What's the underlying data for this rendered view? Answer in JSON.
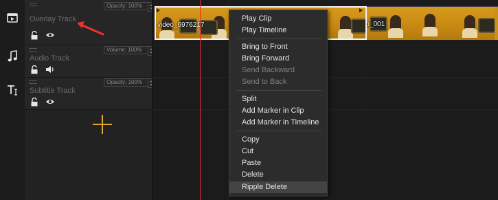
{
  "tracks": [
    {
      "name": "Overlay Track",
      "param": "Opacity: 100%",
      "icon": "play-box-icon",
      "controls": [
        "lock-icon",
        "eye-icon"
      ]
    },
    {
      "name": "Audio Track",
      "param": "Volume: 100%",
      "icon": "music-note-icon",
      "controls": [
        "lock-icon",
        "speaker-icon"
      ]
    },
    {
      "name": "Subtitle Track",
      "param": "Opacity: 100%",
      "icon": "text-icon",
      "controls": [
        "lock-icon",
        "eye-icon"
      ]
    }
  ],
  "clips": [
    {
      "label": "video_6976217",
      "selected": true
    },
    {
      "label": "video_001"
    }
  ],
  "context_menu": {
    "groups": [
      [
        {
          "label": "Play Clip",
          "enabled": true
        },
        {
          "label": "Play Timeline",
          "enabled": true
        }
      ],
      [
        {
          "label": "Bring to Front",
          "enabled": true
        },
        {
          "label": "Bring Forward",
          "enabled": true
        },
        {
          "label": "Send Backward",
          "enabled": false
        },
        {
          "label": "Send to Back",
          "enabled": false
        }
      ],
      [
        {
          "label": "Split",
          "enabled": true
        },
        {
          "label": "Add Marker in Clip",
          "enabled": true
        },
        {
          "label": "Add Marker in Timeline",
          "enabled": true
        }
      ],
      [
        {
          "label": "Copy",
          "enabled": true
        },
        {
          "label": "Cut",
          "enabled": true
        },
        {
          "label": "Paste",
          "enabled": true
        },
        {
          "label": "Delete",
          "enabled": true
        },
        {
          "label": "Ripple Delete",
          "enabled": true,
          "highlighted": true
        }
      ]
    ]
  },
  "colors": {
    "accent_add": "#e0a92a",
    "playhead": "#d8322b",
    "annotation_arrow": "#e8352b",
    "clip_selected_border": "#f2f2f2"
  }
}
